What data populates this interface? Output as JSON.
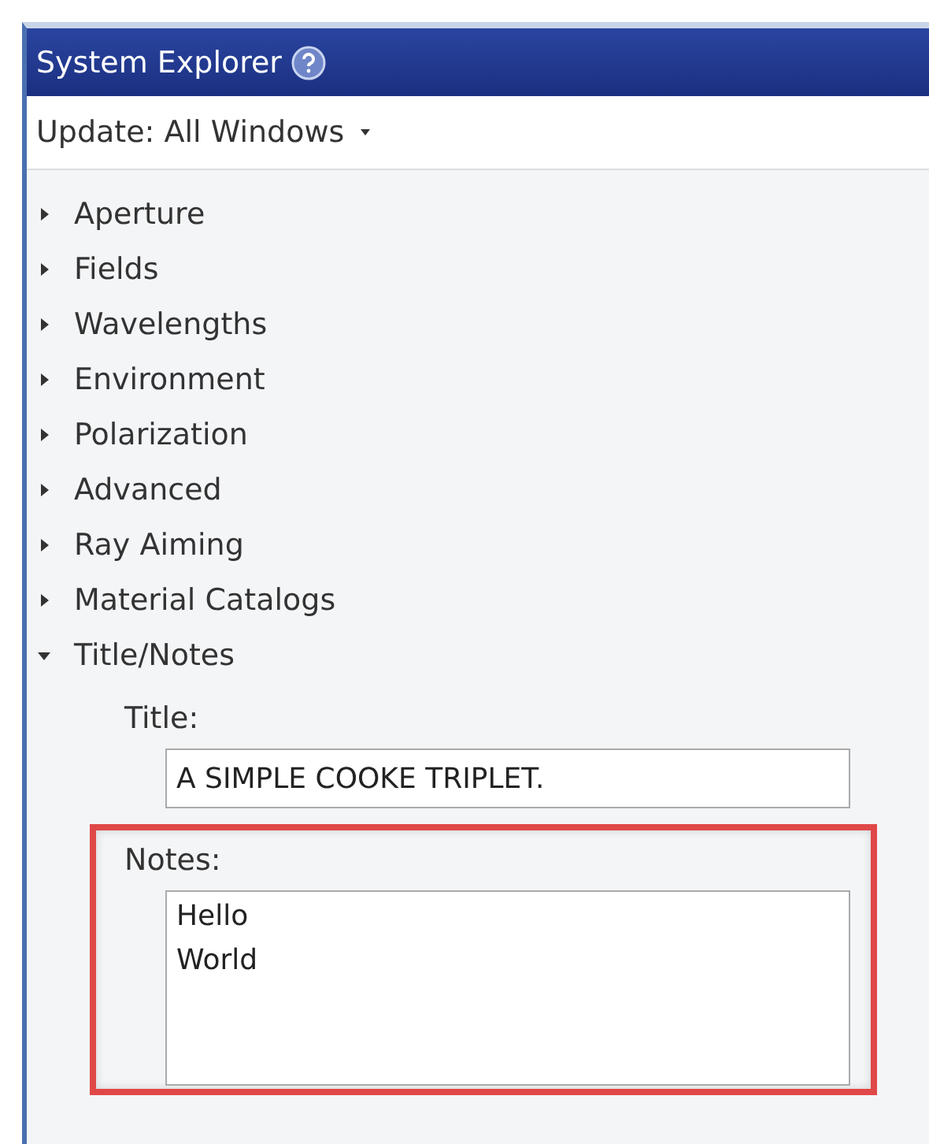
{
  "panel": {
    "title": "System Explorer",
    "update": "Update: All Windows"
  },
  "tree": [
    {
      "label": "Aperture",
      "expanded": false
    },
    {
      "label": "Fields",
      "expanded": false
    },
    {
      "label": "Wavelengths",
      "expanded": false
    },
    {
      "label": "Environment",
      "expanded": false
    },
    {
      "label": "Polarization",
      "expanded": false
    },
    {
      "label": "Advanced",
      "expanded": false
    },
    {
      "label": "Ray Aiming",
      "expanded": false
    },
    {
      "label": "Material Catalogs",
      "expanded": false
    },
    {
      "label": "Title/Notes",
      "expanded": true,
      "fields": [
        {
          "label": "Title:",
          "value": "A SIMPLE COOKE TRIPLET.",
          "kind": "line",
          "highlighted": false
        },
        {
          "label": "Notes:",
          "value": "Hello\nWorld",
          "kind": "multiline",
          "highlighted": true
        }
      ]
    }
  ]
}
